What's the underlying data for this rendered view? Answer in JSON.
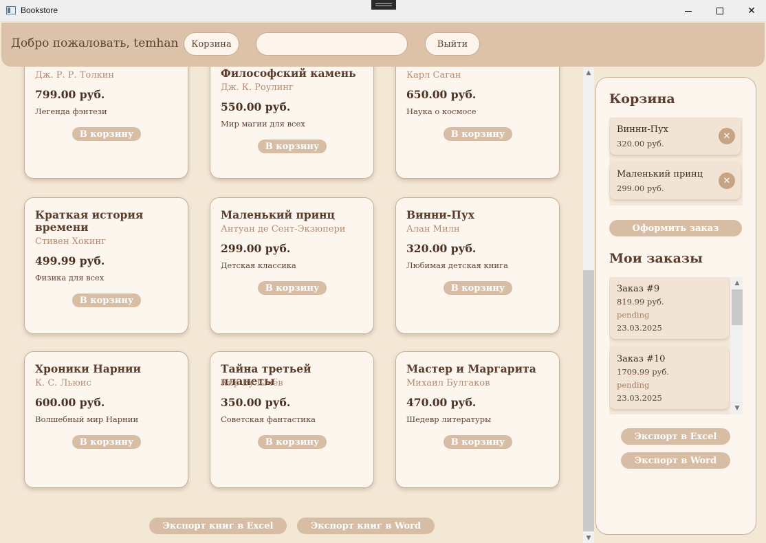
{
  "window": {
    "title": "Bookstore"
  },
  "header": {
    "welcome": "Добро пожаловать, temhan",
    "cart_label": "Корзина",
    "search_value": "",
    "logout_label": "Выйти"
  },
  "books": [
    {
      "title": "",
      "author": "Дж. Р. Р. Толкин",
      "price": "799.00 руб.",
      "description": "Легенда фэнтези",
      "button": "В корзину"
    },
    {
      "title": "Философский камень",
      "author": "Дж. К. Роулинг",
      "price": "550.00 руб.",
      "description": "Мир магии для всех",
      "button": "В корзину"
    },
    {
      "title": "",
      "author": "Карл Саган",
      "price": "650.00 руб.",
      "description": "Наука о космосе",
      "button": "В корзину"
    },
    {
      "title": "Краткая история времени",
      "author": "Стивен Хокинг",
      "price": "499.99 руб.",
      "description": "Физика для всех",
      "button": "В корзину"
    },
    {
      "title": "Маленький принц",
      "author": "Антуан де Сент-Экзюпери",
      "price": "299.00 руб.",
      "description": "Детская классика",
      "button": "В корзину"
    },
    {
      "title": "Винни-Пух",
      "author": "Алан Милн",
      "price": "320.00 руб.",
      "description": "Любимая детская книга",
      "button": "В корзину"
    },
    {
      "title": "Хроники Нарнии",
      "author": "К. С. Льюис",
      "price": "600.00 руб.",
      "description": "Волшебный мир Нарнии",
      "button": "В корзину"
    },
    {
      "title": "Тайна третьей планеты",
      "author": "Кир Булычёв",
      "price": "350.00 руб.",
      "description": "Советская фантастика",
      "button": "В корзину"
    },
    {
      "title": "Мастер и Маргарита",
      "author": "Михаил Булгаков",
      "price": "470.00 руб.",
      "description": "Шедевр литературы",
      "button": "В корзину"
    }
  ],
  "books_footer": {
    "export_excel": "Экспорт книг в Excel",
    "export_word": "Экспорт книг в Word"
  },
  "side": {
    "cart_heading": "Корзина",
    "cart_items": [
      {
        "title": "Винни-Пух",
        "price": "320.00 руб."
      },
      {
        "title": "Маленький принц",
        "price": "299.00 руб."
      }
    ],
    "checkout_label": "Оформить заказ",
    "orders_heading": "Мои заказы",
    "orders": [
      {
        "title": "Заказ #9",
        "sum": "819.99 руб.",
        "status": "pending",
        "date": "23.03.2025"
      },
      {
        "title": "Заказ #10",
        "sum": "1709.99 руб.",
        "status": "pending",
        "date": "23.03.2025"
      }
    ],
    "export_excel": "Экспорт в Excel",
    "export_word": "Экспорт в Word"
  }
}
